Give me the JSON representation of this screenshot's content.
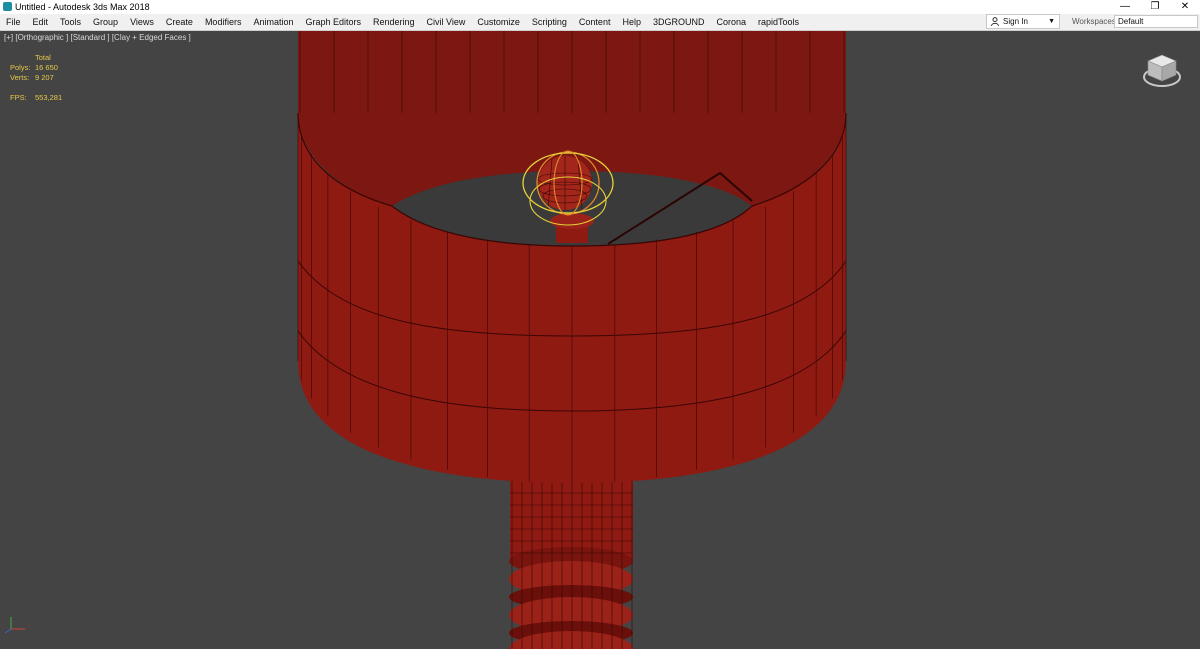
{
  "window": {
    "title": "Untitled - Autodesk 3ds Max 2018",
    "controls": [
      "—",
      "❐",
      "✕"
    ]
  },
  "menu": [
    "File",
    "Edit",
    "Tools",
    "Group",
    "Views",
    "Create",
    "Modifiers",
    "Animation",
    "Graph Editors",
    "Rendering",
    "Civil View",
    "Customize",
    "Scripting",
    "Content",
    "Help",
    "3DGROUND",
    "Corona",
    "rapidTools"
  ],
  "account": {
    "signin_label": "Sign In"
  },
  "workspaces": {
    "label": "Workspaces:",
    "value": "Default"
  },
  "viewport": {
    "label": "[+] [Orthographic ] [Standard ] [Clay + Edged Faces ]",
    "stats": {
      "header": "Total",
      "polys_label": "Polys:",
      "polys_value": "16 650",
      "verts_label": "Verts:",
      "verts_value": "9 207",
      "fps_label": "FPS:",
      "fps_value": "553,281"
    }
  },
  "colors": {
    "viewport_bg": "#444444",
    "mesh_red": "#8e1a12",
    "mesh_dark": "#6a0f0a",
    "wire": "#3a0604",
    "gizmo_yellow": "#e6d23a",
    "gizmo_orange": "#e08a2a",
    "stats_text": "#e6c84a"
  }
}
